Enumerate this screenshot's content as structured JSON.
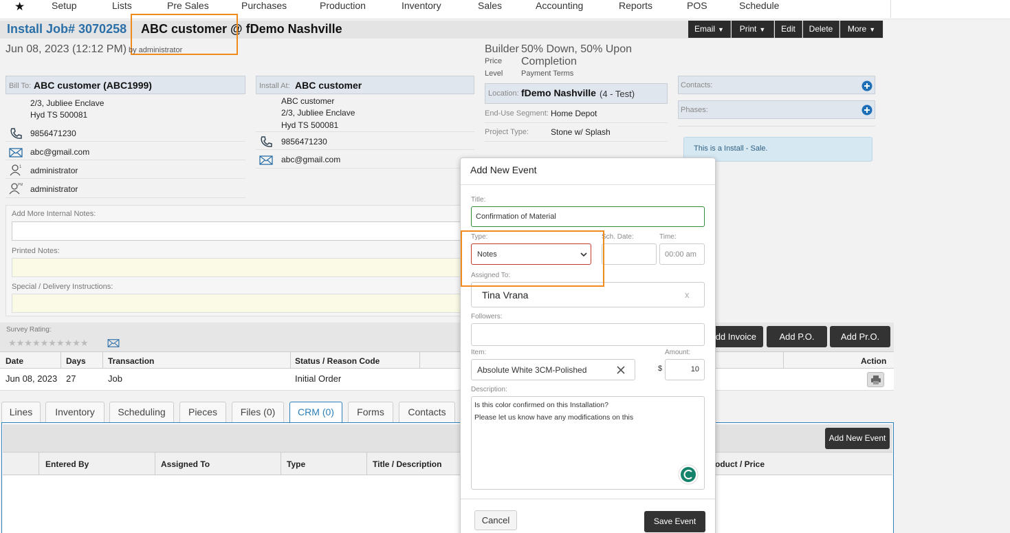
{
  "nav": {
    "items": [
      "Setup",
      "Lists",
      "Pre Sales",
      "Purchases",
      "Production",
      "Inventory",
      "Sales",
      "Accounting",
      "Reports",
      "POS",
      "Schedule"
    ]
  },
  "header": {
    "job_link": "Install Job# 3070258",
    "job_rest": "ABC customer @ fDemo Nashville",
    "buttons": [
      "Email",
      "Print",
      "Edit",
      "Delete",
      "More"
    ]
  },
  "meta": {
    "date": "Jun 08, 2023 (12:12 PM)",
    "by": "by administrator"
  },
  "builder": {
    "price_level_label_1": "Builder",
    "price_level_label_2": "Price",
    "price_level_label_3": "Level",
    "terms_1": "50% Down, 50% Upon",
    "terms_2": "Completion",
    "terms_label": "Payment Terms"
  },
  "bill_to": {
    "label": "Bill To:",
    "name": "ABC customer (ABC1999)",
    "address_1": "2/3, Jubliee Enclave",
    "address_2": "Hyd TS 500081",
    "phone": "9856471230",
    "email": "abc@gmail.com",
    "salesperson": "administrator",
    "pm": "administrator"
  },
  "install_at": {
    "label": "Install At:",
    "name": "ABC customer",
    "line_1": "ABC customer",
    "address_1": "2/3, Jubliee Enclave",
    "address_2": "Hyd TS 500081",
    "phone": "9856471230",
    "email": "abc@gmail.com"
  },
  "location": {
    "label": "Location:",
    "name": "fDemo Nashville",
    "suffix": "(4 - Test)",
    "segment_label": "End-Use Segment:",
    "segment": "Home Depot",
    "project_label": "Project Type:",
    "project": "Stone w/ Splash"
  },
  "side": {
    "contacts_label": "Contacts:",
    "phases_label": "Phases:",
    "info": "This is a Install - Sale."
  },
  "notes": {
    "internal_label": "Add More Internal Notes:",
    "printed_label": "Printed Notes:",
    "special_label": "Special / Delivery Instructions:"
  },
  "survey": {
    "label": "Survey Rating:"
  },
  "actions": {
    "add_invoice": "Add Invoice",
    "add_po": "Add P.O.",
    "add_pro": "Add Pr.O."
  },
  "transactions": {
    "headers": [
      "Date",
      "Days",
      "Transaction",
      "Status / Reason Code",
      "Action"
    ],
    "row": [
      "Jun 08, 2023",
      "27",
      "Job",
      "Initial Order"
    ]
  },
  "tabs": [
    "Lines",
    "Inventory",
    "Scheduling",
    "Pieces",
    "Files (0)",
    "CRM (0)",
    "Forms",
    "Contacts"
  ],
  "crm": {
    "add_event": "Add New Event",
    "headers": [
      "Entered By",
      "Assigned To",
      "Type",
      "Title / Description",
      "oduct / Price"
    ]
  },
  "modal": {
    "title": "Add New Event",
    "title_label": "Title:",
    "title_value": "Confirmation of Material",
    "type_label": "Type:",
    "type_value": "Notes",
    "sch_date_label": "Sch. Date:",
    "time_label": "Time:",
    "time_placeholder": "00:00 am",
    "assigned_label": "Assigned To:",
    "assigned_value": "Tina Vrana",
    "assigned_clear": "x",
    "followers_label": "Followers:",
    "item_label": "Item:",
    "item_value": "Absolute White 3CM-Polished",
    "amount_label": "Amount:",
    "currency": "$",
    "amount_value": "10",
    "description_label": "Description:",
    "description_line_1": "Is this color confirmed on this Installation?",
    "description_line_2": "Please let us know have any modifications on this",
    "cancel": "Cancel",
    "save": "Save Event"
  },
  "colors": {
    "accent_blue": "#2a6fa8",
    "highlight_orange": "#f08a1c",
    "title_border_green": "#2e8b3a",
    "type_border_red": "#c0392b",
    "info_bg": "#d6e8f2"
  }
}
